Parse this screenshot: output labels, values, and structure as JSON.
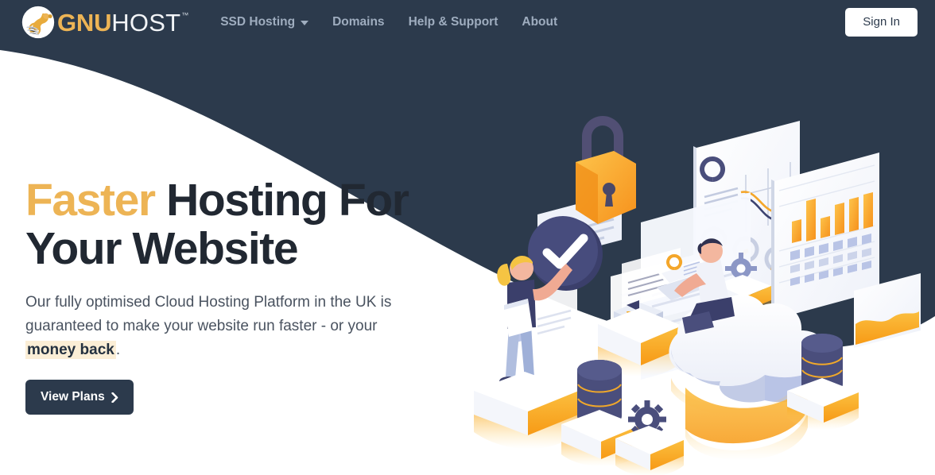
{
  "theme": {
    "navy": "#2c3a4c",
    "navy_dark": "#212832",
    "gold": "#edb455",
    "gold_strong": "#f9a826",
    "orange": "#f7931e",
    "nav_text": "#9fadbf",
    "body_text": "#4a5360",
    "highlight_bg": "#fbeed6",
    "white": "#ffffff",
    "periwinkle": "#b9c4e6",
    "indigo": "#4a4e7c"
  },
  "navbar": {
    "brand": {
      "mark_icon": "gnu-wildebeest-logo-icon",
      "name_primary": "GNU",
      "name_secondary": "HOST",
      "trademark": "™"
    },
    "links": [
      {
        "label": "SSD Hosting",
        "has_dropdown": true,
        "icon": "chevron-down-icon"
      },
      {
        "label": "Domains",
        "has_dropdown": false
      },
      {
        "label": "Help & Support",
        "has_dropdown": false
      },
      {
        "label": "About",
        "has_dropdown": false
      }
    ],
    "sign_in_label": "Sign In"
  },
  "hero": {
    "title_accent": "Faster",
    "title_rest": " Hosting For Your Website",
    "title_line1_accent": "Faster",
    "title_line1_rest": " Hosting For",
    "title_line2": "Your Website",
    "subtitle_part1": "Our fully optimised Cloud Hosting Platform in the UK is guaranteed to make your website run faster - or your ",
    "subtitle_highlight": "money back",
    "subtitle_part3": ".",
    "cta_label": "View Plans",
    "cta_icon": "chevron-right-icon",
    "illustration": {
      "name": "isometric-cloud-hosting-illustration",
      "elements": [
        "padlock-icon",
        "checkmark-badge-icon",
        "woman-standing-figure",
        "man-with-laptop-figure",
        "cloud-platform",
        "database-cylinder",
        "gear-icon",
        "pie-chart-panel",
        "bar-chart-panel",
        "line-chart-panel",
        "donut-chart-panel",
        "area-chart-panel",
        "document-panels"
      ]
    }
  }
}
